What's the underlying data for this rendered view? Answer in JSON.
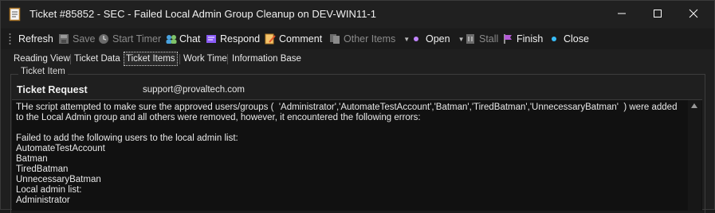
{
  "window": {
    "title": "Ticket #85852 - SEC - Failed Local Admin Group Cleanup on DEV-WIN11-1",
    "minimize_glyph": "—",
    "maximize_glyph": "☐",
    "close_glyph": "✕"
  },
  "toolbar": {
    "refresh": "Refresh",
    "save": "Save",
    "start_timer": "Start Timer",
    "chat": "Chat",
    "respond": "Respond",
    "comment": "Comment",
    "other_items": "Other Items",
    "open": "Open",
    "stall": "Stall",
    "finish": "Finish",
    "close": "Close"
  },
  "tabs": [
    {
      "label": "Reading View"
    },
    {
      "label": "Ticket Data"
    },
    {
      "label": "Ticket Items"
    },
    {
      "label": "Work Time"
    },
    {
      "label": "Information Base"
    }
  ],
  "ticket_item": {
    "group_label": "Ticket Item",
    "request_label": "Ticket Request",
    "request_email": "support@provaltech.com",
    "body": "THe script attempted to make sure the approved users/groups (  'Administrator','AutomateTestAccount','Batman','TiredBatman','UnnecessaryBatman'  ) were added to the Local Admin group and all others were removed, however, it encountered the following errors:\n\nFailed to add the following users to the local admin list:\nAutomateTestAccount\nBatman\nTiredBatman\nUnnecessaryBatman\nLocal admin list:\nAdministrator"
  },
  "colors": {
    "background": "#1f1f1f",
    "textarea_bg": "#111111",
    "accent_purple": "#c084fc",
    "accent_teal": "#38bdf8"
  }
}
